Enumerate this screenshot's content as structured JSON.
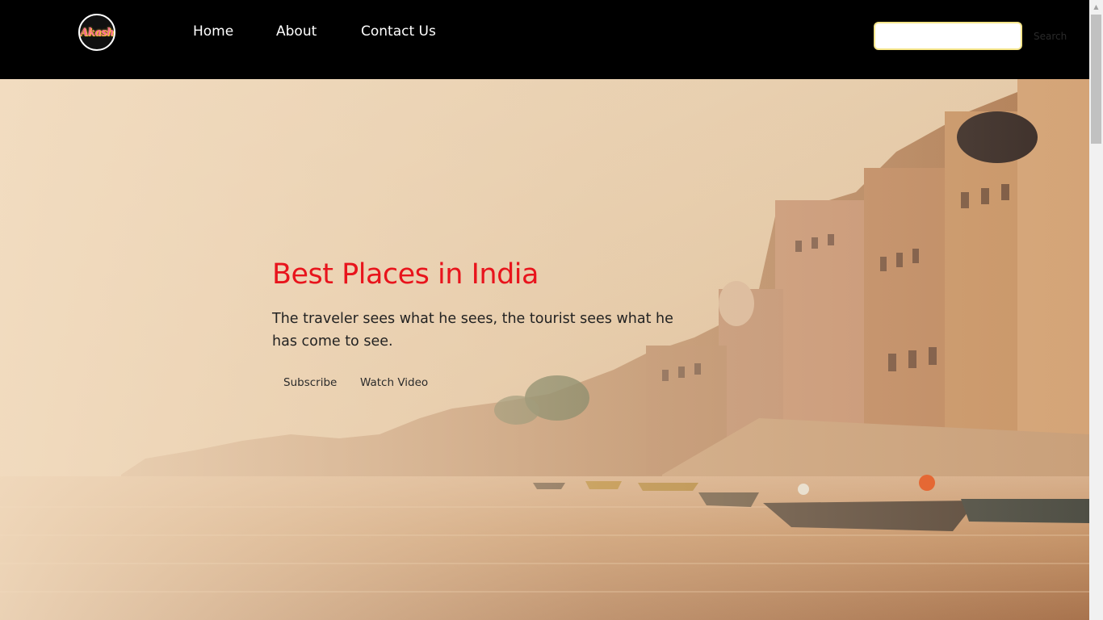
{
  "logo": {
    "text": "Akash"
  },
  "nav": {
    "items": [
      {
        "label": "Home"
      },
      {
        "label": "About"
      },
      {
        "label": "Contact Us"
      }
    ]
  },
  "search": {
    "value": "",
    "button_label": "Search"
  },
  "hero": {
    "title": "Best Places in India",
    "text": "The traveler sees what he sees, the tourist sees what he has come to see.",
    "buttons": [
      {
        "label": "Subscribe"
      },
      {
        "label": "Watch Video"
      }
    ]
  },
  "colors": {
    "navbar_bg": "#000000",
    "title": "#e8141c",
    "search_border": "#f5e58a"
  }
}
